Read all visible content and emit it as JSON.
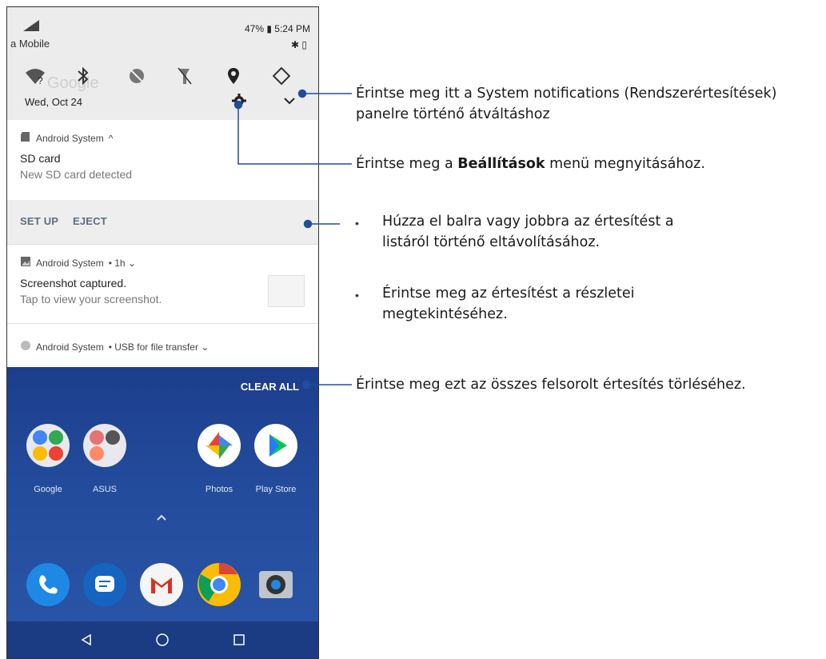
{
  "status": {
    "battery": "47%",
    "time": "5:24 PM",
    "carrier": "a Mobile"
  },
  "quick_settings": {
    "date": "Wed, Oct 24",
    "tiles": [
      "wifi-icon",
      "bluetooth-icon",
      "dnd-icon",
      "flashlight-icon",
      "location-icon",
      "auto-rotate-icon"
    ],
    "ghost_text": "Google"
  },
  "notifications": [
    {
      "app": "Android System",
      "suffix": "^",
      "title": "SD card",
      "text": "New SD card detected",
      "actions": [
        "SET UP",
        "EJECT"
      ]
    },
    {
      "app": "Android System",
      "suffix": "• 1h ⌄",
      "title": "Screenshot captured.",
      "text": "Tap to view your screenshot."
    },
    {
      "app": "Android System",
      "suffix": "• USB for file transfer ⌄"
    }
  ],
  "home": {
    "clear_all": "CLEAR ALL",
    "apps": [
      "Google",
      "ASUS",
      "Photos",
      "Play Store"
    ]
  },
  "callouts": {
    "c1_line1": "Érintse meg itt a System notifications (Rendszerértesítések)",
    "c1_line2": "panelre történő átváltáshoz",
    "c2_pre": "Érintse meg a ",
    "c2_bold": "Beállítások",
    "c2_post": " menü megnyitásához.",
    "c3_line1": "Húzza el balra vagy jobbra az értesítést a",
    "c3_line2": "listáról történő eltávolításához.",
    "c4_line1": "Érintse meg az értesítést a részletei",
    "c4_line2": "megtekintéséhez.",
    "c5": "Érintse meg ezt az összes felsorolt értesítés törléséhez."
  },
  "colors": {
    "callout_line": "#1f4e9c",
    "home_bg": "#234b9c",
    "action_text": "#5f6b86"
  }
}
